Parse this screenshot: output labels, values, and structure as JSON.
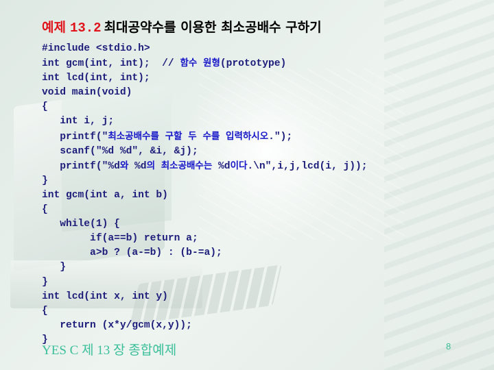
{
  "title": {
    "label": "예제",
    "number": "13.2",
    "text": "최대공약수를 이용한 최소공배수 구하기"
  },
  "code_lines": [
    "#include <stdio.h>",
    "int gcm(int, int);  // 함수 원형(prototype)",
    "int lcd(int, int);",
    "void main(void)",
    "{",
    "   int i, j;",
    "   printf(\"최소공배수를 구할 두 수를 입력하시오.\");",
    "   scanf(\"%d %d\", &i, &j);",
    "   printf(\"%d와 %d의 최소공배수는 %d이다.\\n\",i,j,lcd(i, j));",
    "}",
    "int gcm(int a, int b)",
    "{",
    "   while(1) {",
    "        if(a==b) return a;",
    "        a>b ? (a-=b) : (b-=a);",
    "   }",
    "}",
    "int lcd(int x, int y)",
    "{",
    "   return (x*y/gcm(x,y));",
    "}"
  ],
  "footer": "YES C  제 13 장 종합예제",
  "page_number": "8",
  "colors": {
    "title_accent": "#e0121a",
    "code": "#1c1c7a",
    "footer": "#3bbf9a"
  }
}
